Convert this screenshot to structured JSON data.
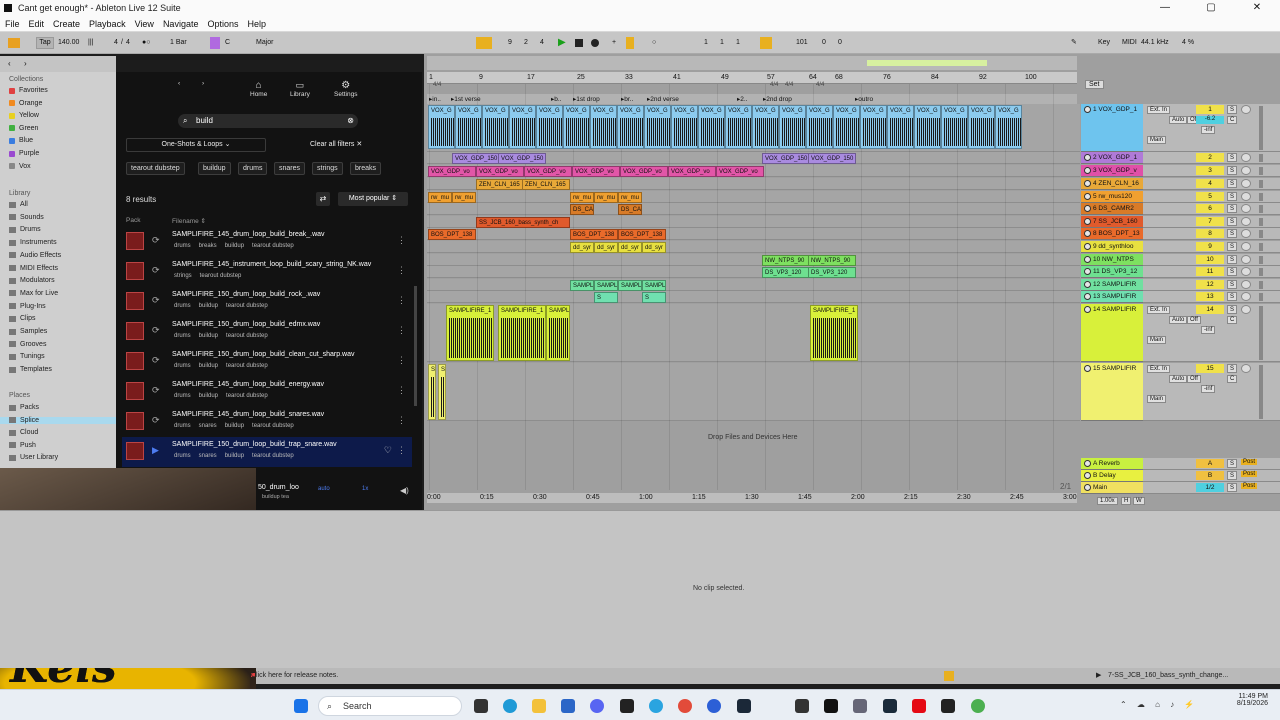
{
  "window": {
    "title": "Cant get enough* - Ableton Live 12 Suite"
  },
  "menu": [
    "File",
    "Edit",
    "Create",
    "Playback",
    "View",
    "Navigate",
    "Options",
    "Help"
  ],
  "transport": {
    "tap": "Tap",
    "tempo": "140.00",
    "time_sig_num": "4",
    "time_sig_den": "4",
    "quantize": "1 Bar",
    "key": "C",
    "scale": "Major",
    "position": [
      "9",
      "2",
      "4"
    ],
    "loop_start": [
      "1",
      "1",
      "1"
    ],
    "loop_len": [
      "101",
      "0",
      "0"
    ],
    "right_key": "Key",
    "right_midi": "MIDI",
    "sample_rate": "44.1 kHz",
    "cpu": "4 %"
  },
  "sidebar": {
    "collections_heading": "Collections",
    "collections": [
      {
        "label": "Favorites",
        "color": "#e04040"
      },
      {
        "label": "Orange",
        "color": "#f08a20"
      },
      {
        "label": "Yellow",
        "color": "#e8d020"
      },
      {
        "label": "Green",
        "color": "#40b040"
      },
      {
        "label": "Blue",
        "color": "#3a7de0"
      },
      {
        "label": "Purple",
        "color": "#9a4ad0"
      },
      {
        "label": "Vox",
        "color": "#888888"
      }
    ],
    "library_heading": "Library",
    "library": [
      "All",
      "Sounds",
      "Drums",
      "Instruments",
      "Audio Effects",
      "MIDI Effects",
      "Modulators",
      "Max for Live",
      "Plug-Ins",
      "Clips",
      "Samples",
      "Grooves",
      "Tunings",
      "Templates"
    ],
    "places_heading": "Places",
    "places": [
      "Packs",
      "Splice",
      "Cloud",
      "Push",
      "User Library"
    ]
  },
  "splice": {
    "nav": {
      "home": "Home",
      "library": "Library",
      "settings": "Settings"
    },
    "search_value": "build",
    "filter_type": "One-Shots & Loops",
    "clear_filters": "Clear all filters",
    "chips": [
      "tearout dubstep",
      "buildup",
      "drums",
      "snares",
      "strings",
      "breaks"
    ],
    "results": "8 results",
    "sort": "Most popular",
    "col_pack": "Pack",
    "col_filename": "Filename",
    "rows": [
      {
        "name": "SAMPLIFIRE_145_drum_loop_build_break_.wav",
        "tags": [
          "drums",
          "breaks",
          "buildup",
          "tearout dubstep"
        ]
      },
      {
        "name": "SAMPLIFIRE_145_instrument_loop_build_scary_string_NK.wav",
        "tags": [
          "strings",
          "tearout dubstep"
        ]
      },
      {
        "name": "SAMPLIFIRE_150_drum_loop_build_rock_.wav",
        "tags": [
          "drums",
          "buildup",
          "tearout dubstep"
        ]
      },
      {
        "name": "SAMPLIFIRE_150_drum_loop_build_edmx.wav",
        "tags": [
          "drums",
          "buildup",
          "tearout dubstep"
        ]
      },
      {
        "name": "SAMPLIFIRE_150_drum_loop_build_clean_cut_sharp.wav",
        "tags": [
          "drums",
          "buildup",
          "tearout dubstep"
        ]
      },
      {
        "name": "SAMPLIFIRE_145_drum_loop_build_energy.wav",
        "tags": [
          "drums",
          "buildup",
          "tearout dubstep"
        ]
      },
      {
        "name": "SAMPLIFIRE_145_drum_loop_build_snares.wav",
        "tags": [
          "drums",
          "snares",
          "buildup",
          "tearout dubstep"
        ]
      },
      {
        "name": "SAMPLIFIRE_150_drum_loop_build_trap_snare.wav",
        "tags": [
          "drums",
          "snares",
          "buildup",
          "tearout dubstep"
        ]
      }
    ],
    "player": {
      "name": "50_drum_loo",
      "tag1": "buildup",
      "tag2": "tea",
      "key": "auto",
      "bpm": "1x"
    }
  },
  "arrangement": {
    "ruler": [
      "1",
      "9",
      "17",
      "25",
      "33",
      "41",
      "49",
      "57",
      "64",
      "68",
      "76",
      "84",
      "92",
      "100"
    ],
    "ruler_sig": [
      "4/4",
      "4/4",
      "4/4",
      "4/4"
    ],
    "locators": [
      "in..",
      "1st verse",
      "b..",
      "1st drop",
      "br..",
      "2nd verse",
      "2..",
      "2nd drop",
      "outro"
    ],
    "time": [
      "0:00",
      "0:15",
      "0:30",
      "0:45",
      "1:00",
      "1:15",
      "1:30",
      "1:45",
      "2:00",
      "2:15",
      "2:30",
      "2:45",
      "3:00"
    ],
    "fraction": "2/1",
    "drop_hint": "Drop Files and Devices Here",
    "set_label": "Set",
    "clips": {
      "vox1": "VOX_G",
      "vox1b": "VOX_GDP_1",
      "vox_gdp_150": "VOX_GDP_150",
      "vox_gdp_vo": "VOX_GDP_vo",
      "zen": "ZEN_CLN_165",
      "rw_mu": "rw_mu",
      "ds_ca": "DS_CA",
      "ss_jcb": "SS_JCB_160_bass_synth_ch",
      "bos": "BOS_DPT_138",
      "dd_sy": "dd_syr",
      "nw": "NW_NTPS_90",
      "ds_vp3": "DS_VP3_120",
      "samp": "SAMPLIFIR",
      "samp14": "SAMPLIFIRE_1",
      "samp_s": "S"
    }
  },
  "tracks": [
    {
      "label": "1 VOX_GDP_1",
      "color": "#6ec4ee",
      "num": "1",
      "vol": "-6.2"
    },
    {
      "label": "2 VOX_GDP_1",
      "color": "#b07ad8",
      "num": "2"
    },
    {
      "label": "3 VOX_GDP_v",
      "color": "#e050a8",
      "num": "3"
    },
    {
      "label": "4 ZEN_CLN_16",
      "color": "#e8a838",
      "num": "4"
    },
    {
      "label": "5 rw_mus120",
      "color": "#f0a030",
      "num": "5"
    },
    {
      "label": "6 DS_CAMR2",
      "color": "#d87b28",
      "num": "6"
    },
    {
      "label": "7 SS_JCB_160",
      "color": "#e05a2c",
      "num": "7"
    },
    {
      "label": "8 BOS_DPT_13",
      "color": "#e96a2a",
      "num": "8"
    },
    {
      "label": "9 dd_synthloo",
      "color": "#e8e040",
      "num": "9"
    },
    {
      "label": "10 NW_NTPS",
      "color": "#7ee060",
      "num": "10"
    },
    {
      "label": "11 DS_VP3_12",
      "color": "#6ee090",
      "num": "11"
    },
    {
      "label": "12 SAMPLIFIR",
      "color": "#70e0a0",
      "num": "12"
    },
    {
      "label": "13 SAMPLIFIR",
      "color": "#70e0b0",
      "num": "13"
    },
    {
      "label": "14 SAMPLIFIR",
      "color": "#d8f03a",
      "num": "14"
    },
    {
      "label": "15 SAMPLIFIR",
      "color": "#f0f070",
      "num": "15"
    }
  ],
  "returns": [
    {
      "label": "A Reverb",
      "color": "#c8f040",
      "num": "A"
    },
    {
      "label": "B Delay",
      "color": "#e8f040",
      "num": "B"
    },
    {
      "label": "Main",
      "color": "#f0e060",
      "num": "1/2"
    }
  ],
  "mixer": {
    "ext_in": "Ext. In",
    "auto": "Auto",
    "off": "Off",
    "main": "Main",
    "inf": "-inf",
    "c": "C",
    "post": "Post",
    "s": "S",
    "zoom": "1.00x",
    "h": "H",
    "w": "W"
  },
  "detail": {
    "no_clip": "No clip selected."
  },
  "status": {
    "release": "Click here for release notes.",
    "clip": "7-SS_JCB_160_bass_synth_change..."
  },
  "taskbar": {
    "search": "Search",
    "time": "11:49 PM",
    "date": "8/19/2026"
  },
  "branding": {
    "streamer": "Kels"
  }
}
